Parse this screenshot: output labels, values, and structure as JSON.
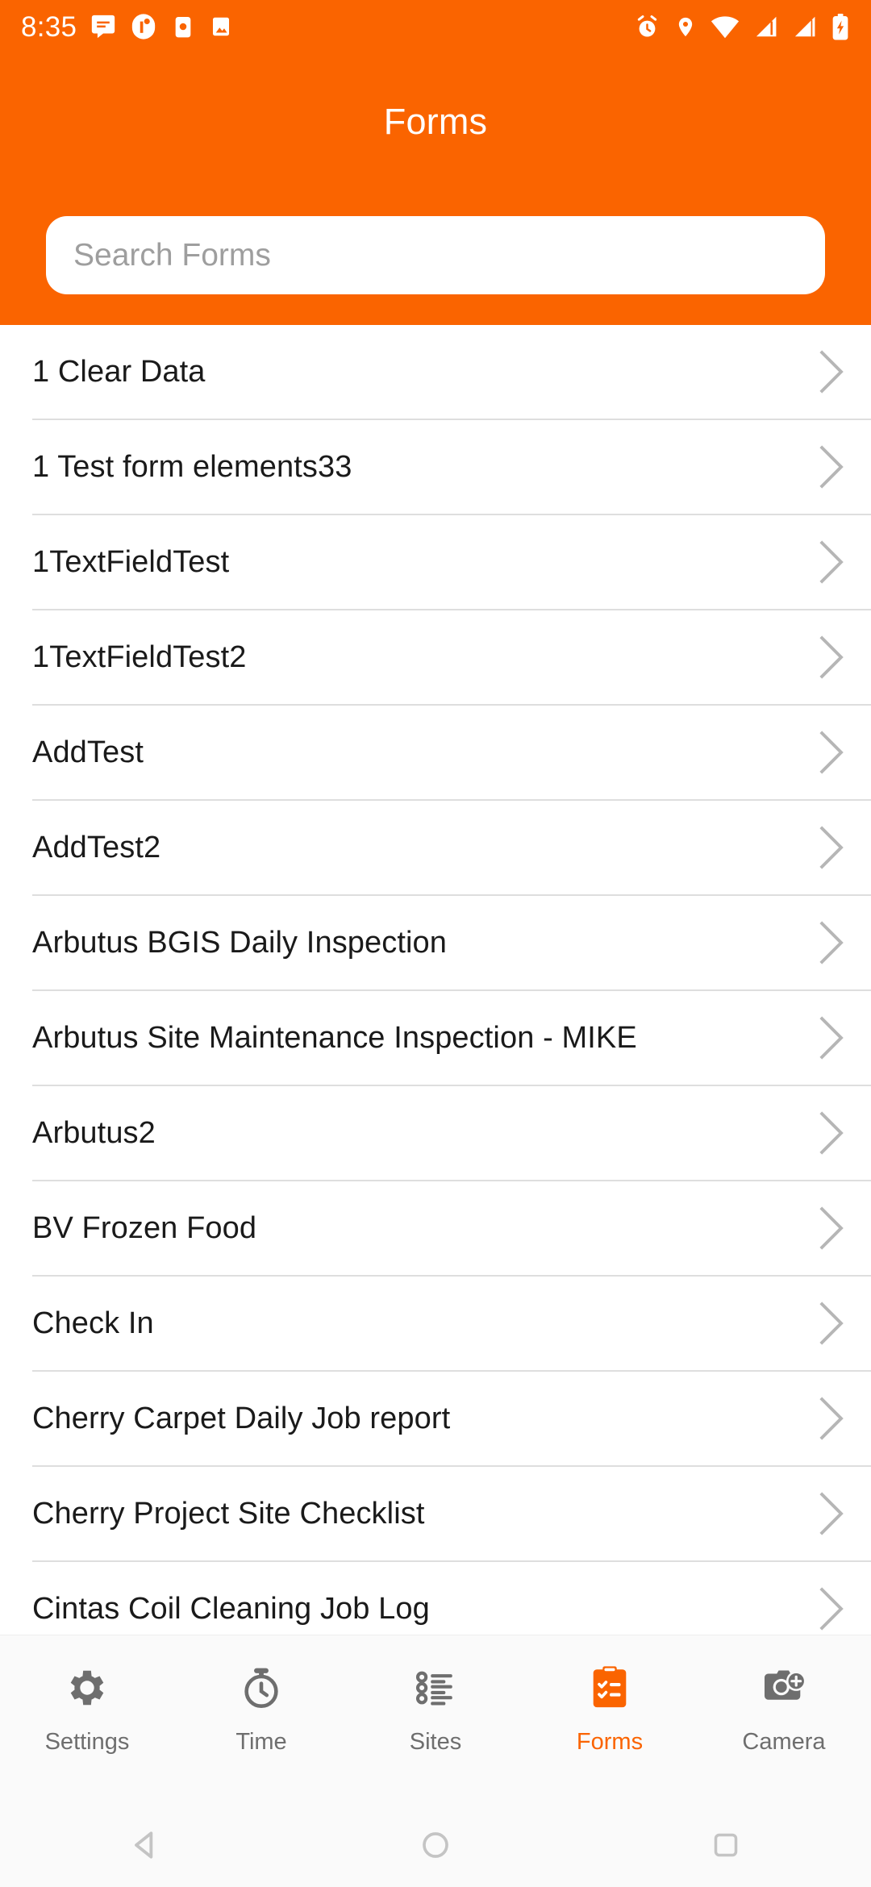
{
  "theme": {
    "accent": "#FA6400",
    "accent_name": "orange",
    "list_text": "#1a1a1a",
    "tab_inactive": "#6e6e6e"
  },
  "status_bar": {
    "time": "8:35",
    "left_icons": [
      "message-icon",
      "app-icon"
    ],
    "right_icons": [
      "alarm-icon",
      "location-icon",
      "wifi-icon",
      "signal-icon",
      "signal-2-icon",
      "battery-charging-icon"
    ]
  },
  "header": {
    "title": "Forms"
  },
  "search": {
    "placeholder": "Search Forms",
    "value": ""
  },
  "list": {
    "items": [
      {
        "label": "1 Clear Data"
      },
      {
        "label": "1 Test form elements33"
      },
      {
        "label": "1TextFieldTest"
      },
      {
        "label": "1TextFieldTest2"
      },
      {
        "label": "AddTest"
      },
      {
        "label": "AddTest2"
      },
      {
        "label": "Arbutus BGIS Daily Inspection"
      },
      {
        "label": "Arbutus Site Maintenance Inspection - MIKE"
      },
      {
        "label": "Arbutus2"
      },
      {
        "label": "BV Frozen Food"
      },
      {
        "label": "Check In"
      },
      {
        "label": "Cherry Carpet Daily Job report"
      },
      {
        "label": "Cherry Project Site Checklist"
      },
      {
        "label": "Cintas Coil Cleaning Job Log"
      }
    ]
  },
  "tabbar": {
    "tabs": [
      {
        "label": "Settings",
        "icon": "gear-icon",
        "active": false
      },
      {
        "label": "Time",
        "icon": "stopwatch-icon",
        "active": false
      },
      {
        "label": "Sites",
        "icon": "list-icon",
        "active": false
      },
      {
        "label": "Forms",
        "icon": "clipboard-checklist-icon",
        "active": true
      },
      {
        "label": "Camera",
        "icon": "camera-add-icon",
        "active": false
      }
    ]
  },
  "navigation_bar": {
    "buttons": [
      {
        "name": "back-icon"
      },
      {
        "name": "home-icon"
      },
      {
        "name": "recents-icon"
      }
    ]
  }
}
